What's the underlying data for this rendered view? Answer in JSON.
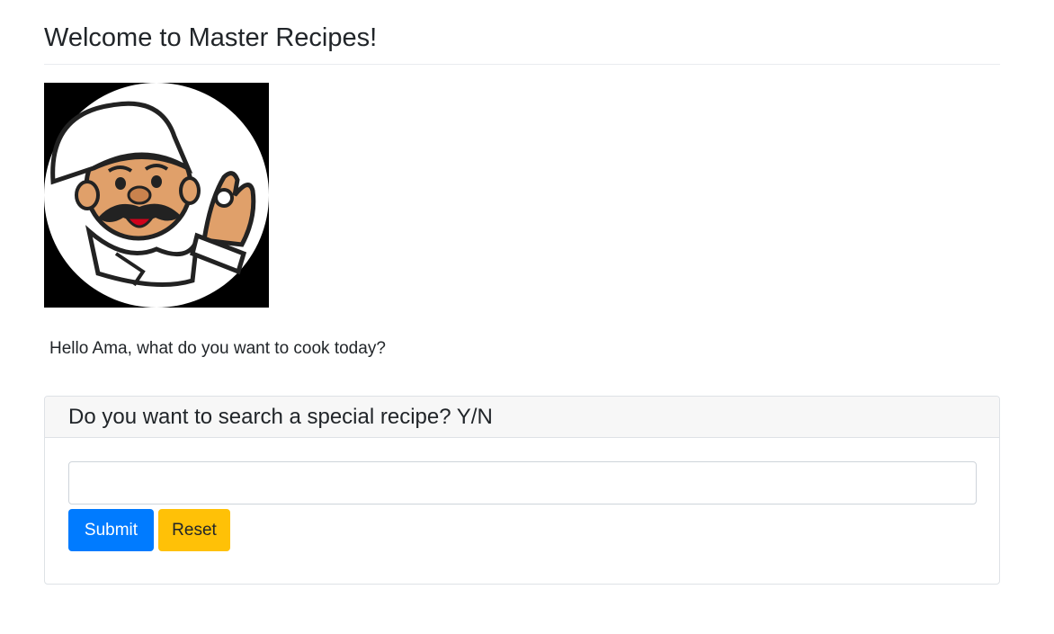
{
  "page": {
    "title": "Welcome to Master Recipes!",
    "greeting": "Hello Ama, what do you want to cook today?"
  },
  "logo": {
    "icon": "chef-mascot-icon"
  },
  "search_card": {
    "question": "Do you want to search a special recipe? Y/N",
    "input_value": "",
    "input_placeholder": "",
    "submit_label": "Submit",
    "reset_label": "Reset"
  },
  "colors": {
    "submit": "#007bff",
    "reset": "#ffc107",
    "text": "#212529"
  }
}
